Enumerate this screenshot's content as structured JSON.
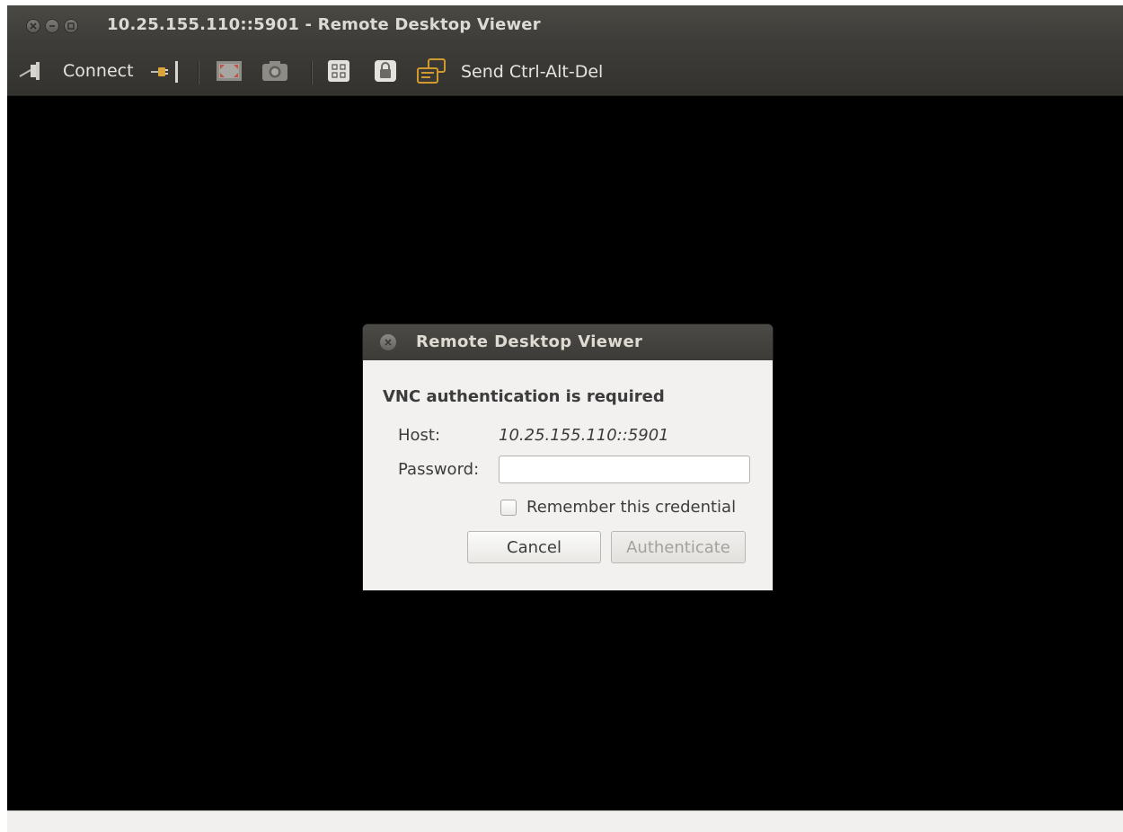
{
  "window": {
    "title": "10.25.155.110::5901 - Remote Desktop Viewer"
  },
  "toolbar": {
    "connect_label": "Connect",
    "send_keys_label": "Send Ctrl-Alt-Del"
  },
  "dialog": {
    "title": "Remote Desktop Viewer",
    "heading": "VNC authentication is required",
    "host_label": "Host:",
    "host_value": "10.25.155.110::5901",
    "password_label": "Password:",
    "password_value": "",
    "remember_label": "Remember this credential",
    "remember_checked": false,
    "cancel_label": "Cancel",
    "authenticate_label": "Authenticate"
  },
  "icons": {
    "close": "close-icon",
    "minimize": "minimize-icon",
    "maximize": "maximize-icon",
    "connect": "plug-connect-icon",
    "disconnect": "plug-disconnect-icon",
    "fullscreen": "fullscreen-icon",
    "screenshot": "camera-icon",
    "scaling": "scale-icon",
    "keyboard_lock": "lock-icon",
    "send_keys": "send-keys-icon"
  },
  "colors": {
    "titlebar": "#3c3b37",
    "viewport": "#000000",
    "dialog_bg": "#f2f1f0"
  }
}
